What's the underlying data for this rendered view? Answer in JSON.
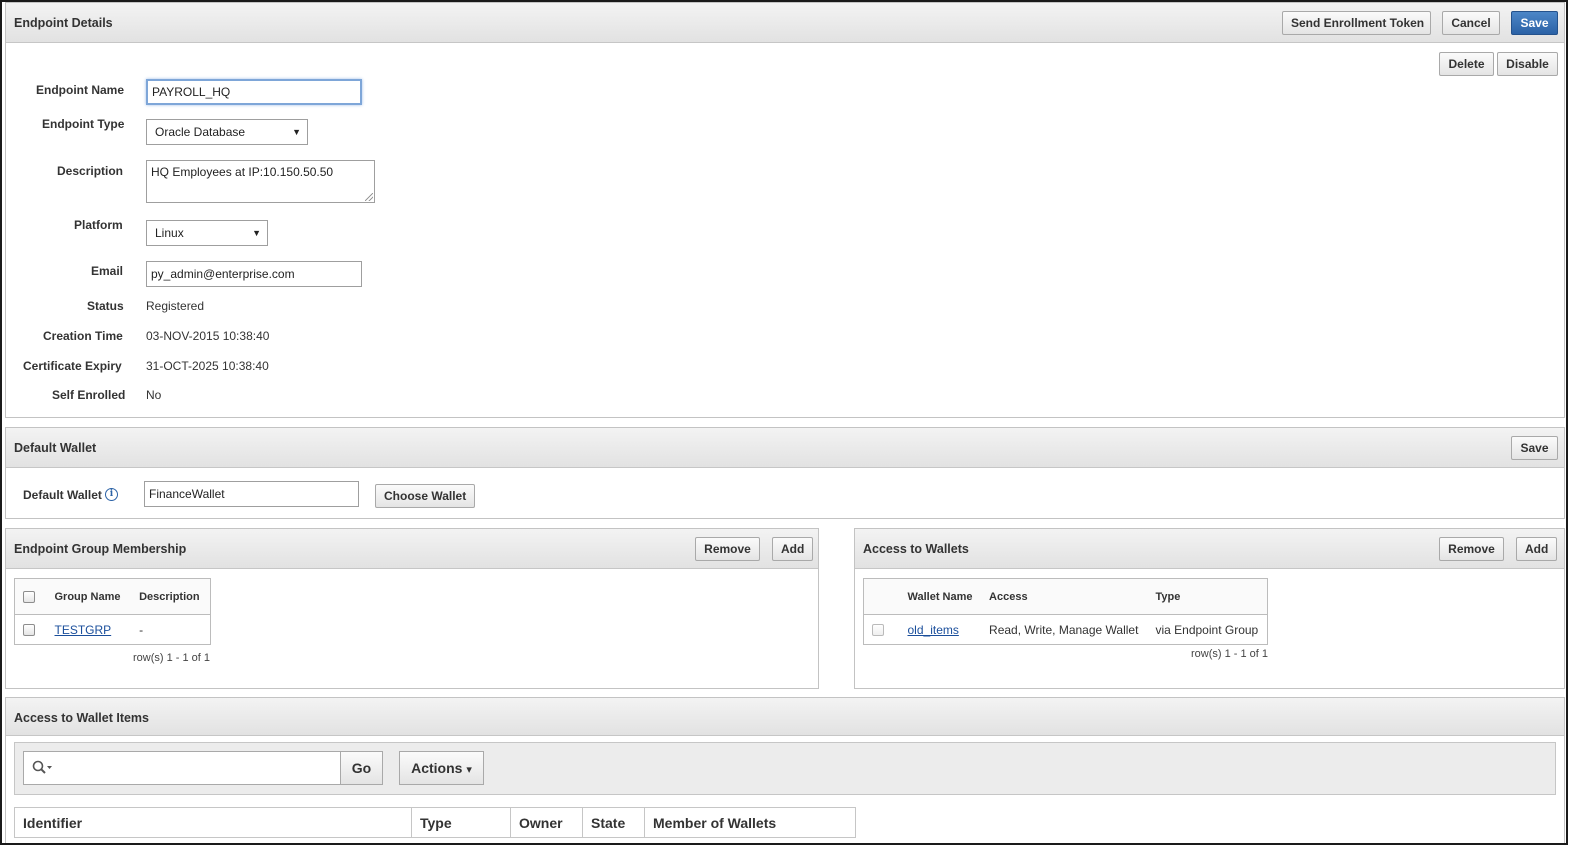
{
  "endpoint_details": {
    "title": "Endpoint Details",
    "buttons": {
      "send_token": "Send Enrollment Token",
      "cancel": "Cancel",
      "save": "Save",
      "delete": "Delete",
      "disable": "Disable"
    },
    "fields": {
      "name_label": "Endpoint Name",
      "name_value": "PAYROLL_HQ",
      "type_label": "Endpoint Type",
      "type_value": "Oracle Database",
      "desc_label": "Description",
      "desc_value": "HQ Employees at IP:10.150.50.50",
      "platform_label": "Platform",
      "platform_value": "Linux",
      "email_label": "Email",
      "email_value": "py_admin@enterprise.com",
      "status_label": "Status",
      "status_value": "Registered",
      "creation_label": "Creation Time",
      "creation_value": "03-NOV-2015 10:38:40",
      "expiry_label": "Certificate Expiry",
      "expiry_value": "31-OCT-2025 10:38:40",
      "self_label": "Self Enrolled",
      "self_value": "No"
    },
    "dropdown_arrow": "▼"
  },
  "default_wallet": {
    "title": "Default Wallet",
    "save": "Save",
    "label": "Default Wallet",
    "info_icon": "i",
    "value": "FinanceWallet",
    "choose": "Choose Wallet"
  },
  "group_membership": {
    "title": "Endpoint Group Membership",
    "remove": "Remove",
    "add": "Add",
    "columns": [
      "Group Name",
      "Description"
    ],
    "rows": [
      {
        "name": "TESTGRP",
        "description": "-"
      }
    ],
    "pagination": "row(s) 1 - 1 of 1"
  },
  "access_wallets": {
    "title": "Access to Wallets",
    "remove": "Remove",
    "add": "Add",
    "columns": [
      "Wallet Name",
      "Access",
      "Type"
    ],
    "rows": [
      {
        "name": "old_items",
        "access": "Read, Write, Manage Wallet",
        "type": "via Endpoint Group"
      }
    ],
    "pagination": "row(s) 1 - 1 of 1"
  },
  "wallet_items": {
    "title": "Access to Wallet Items",
    "search_value": "",
    "go": "Go",
    "actions": "Actions",
    "actions_caret": "▾",
    "columns": [
      "Identifier",
      "Type",
      "Owner",
      "State",
      "Member of Wallets"
    ]
  }
}
